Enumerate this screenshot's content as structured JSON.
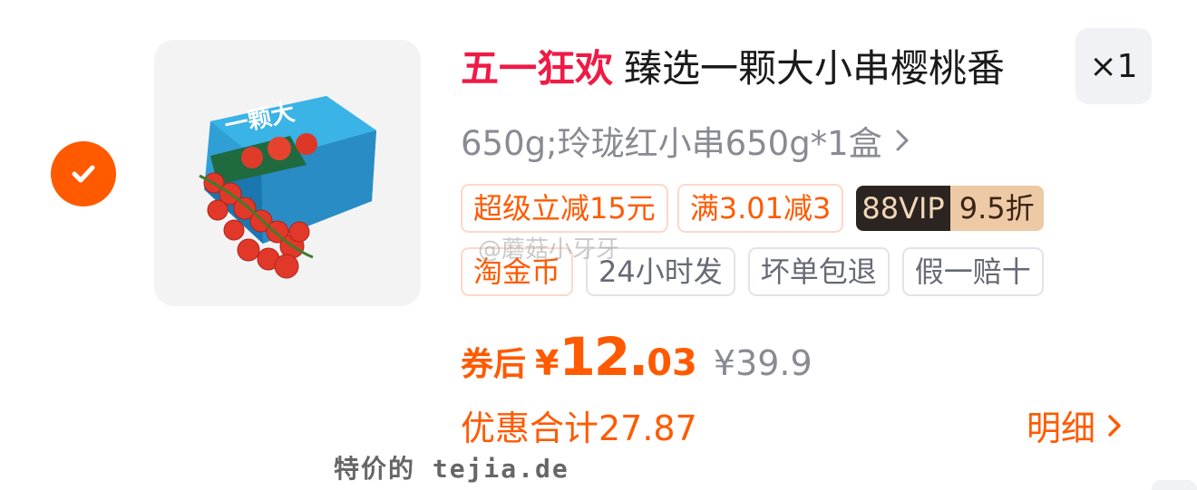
{
  "item": {
    "promo_label": "五一狂欢",
    "name": "臻选一颗大小串樱桃番",
    "quantity": "×1",
    "spec": "650g;玲珑红小串650g*1盒",
    "tags_row1": {
      "instant_discount": "超级立减15元",
      "threshold_discount": "满3.01减3",
      "vip_label": "88VIP",
      "vip_discount": "9.5折"
    },
    "tags_row2": [
      "淘金币",
      "24小时发",
      "坏单包退",
      "假一赔十"
    ],
    "price": {
      "label": "券后",
      "currency": "¥",
      "integer": "12.",
      "decimal": "03",
      "original": "¥39.9"
    },
    "discount_total": "优惠合计27.87",
    "detail_link": "明细",
    "image_brand_text": "一颗大"
  },
  "watermark": "@蘑菇小牙牙",
  "site_mark": "特价的 tejia.de",
  "colors": {
    "accent": "#ff5a00",
    "promo": "#ef1a45",
    "tag_border": "#fbd9c7",
    "vip_dark": "#2b2420",
    "vip_light": "#edc9a6"
  },
  "icons": {
    "checkbox": "check-icon",
    "spec_arrow": "chevron-right-icon",
    "detail_arrow": "chevron-right-icon"
  }
}
